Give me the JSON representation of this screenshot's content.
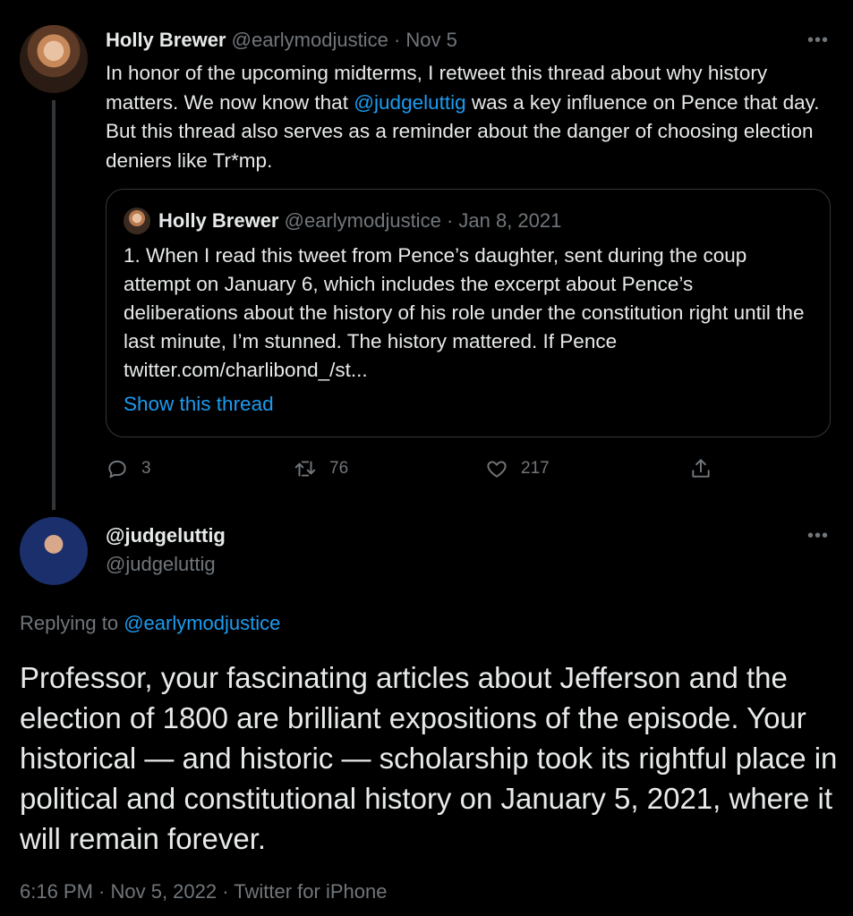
{
  "tweet1": {
    "name": "Holly Brewer",
    "handle": "@earlymodjustice",
    "sep": "·",
    "date": "Nov 5",
    "more": "•••",
    "text_part1": "In honor of the upcoming midterms, I retweet this thread about why history matters. We now know that ",
    "mention": "@judgeluttig",
    "text_part2": " was a key influence on Pence that day. But this thread also serves as a reminder about the danger of choosing election deniers like Tr*mp.",
    "quoted": {
      "name": "Holly Brewer",
      "handle": "@earlymodjustice",
      "sep": "·",
      "date": "Jan 8, 2021",
      "text": "1. When I read this tweet from Pence’s daughter, sent during the coup attempt on January 6, which includes the excerpt about Pence’s deliberations about the history of his role under the constitution right until the last minute, I’m stunned. The history mattered. If Pence twitter.com/charlibond_/st...",
      "show_thread": "Show this thread"
    },
    "actions": {
      "reply_count": "3",
      "retweet_count": "76",
      "like_count": "217",
      "icons": [
        "reply-icon",
        "retweet-icon",
        "like-icon",
        "share-icon"
      ]
    }
  },
  "tweet2": {
    "display_name": "@judgeluttig",
    "handle": "@judgeluttig",
    "more": "•••",
    "replying_prefix": "Replying to ",
    "replying_to": "@earlymodjustice",
    "text": "Professor, your fascinating articles about Jefferson and the election of 1800 are brilliant expositions of the episode. Your historical — and historic — scholarship took its rightful place in political and constitutional history on January 5, 2021, where it will remain forever.",
    "footer": "6:16 PM · Nov 5, 2022 · Twitter for iPhone"
  },
  "colors": {
    "background": "#000000",
    "text": "#e7e9ea",
    "muted": "#71767b",
    "link": "#1d9bf0",
    "border": "#333639"
  }
}
